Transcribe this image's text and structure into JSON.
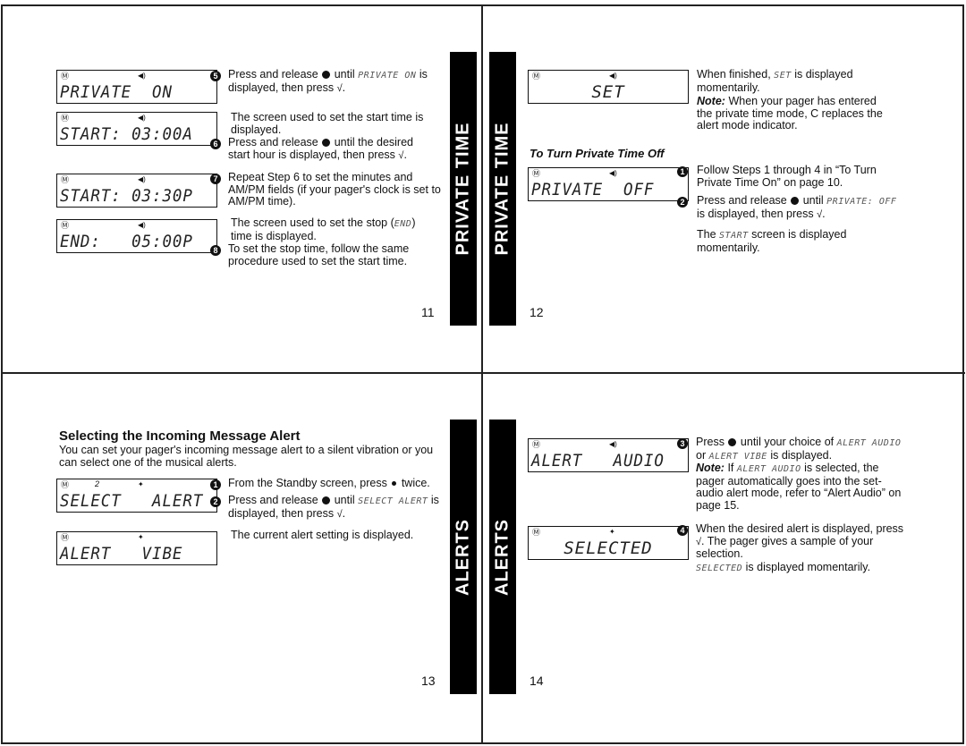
{
  "pages": {
    "p11": {
      "page_number": "11",
      "tab_label": "PRIVATE TIME",
      "lcd_screens": [
        {
          "text": "PRIVATE  ON",
          "logo": "motorola-logo",
          "indicator": "speaker-icon"
        },
        {
          "text": "START: 03:00A",
          "logo": "motorola-logo",
          "indicator": "speaker-icon"
        },
        {
          "text": "START: 03:30P",
          "logo": "motorola-logo",
          "indicator": "speaker-icon"
        },
        {
          "text": "END:   05:00P",
          "logo": "motorola-logo",
          "indicator": "speaker-icon"
        }
      ],
      "steps": [
        {
          "num": "5",
          "pre": "Press and release",
          "mid": "until",
          "lcd": "PRIVATE ON",
          "post": "is displayed, then press",
          "end": "."
        },
        {
          "plain": "The screen used to set the start time is displayed."
        },
        {
          "num": "6",
          "pre": "Press and release",
          "post": "until the desired start hour is displayed, then press",
          "end": "."
        },
        {
          "num": "7",
          "text": "Repeat Step 6 to set the minutes and AM/PM fields (if your pager's clock is set to AM/PM time)."
        },
        {
          "plain_pre": "The screen used to set the stop (",
          "lcd": "END",
          "plain_post": ") time is displayed."
        },
        {
          "num": "8",
          "text": "To set the stop time, follow the same procedure used to set the start time."
        }
      ]
    },
    "p12": {
      "page_number": "12",
      "tab_label": "PRIVATE TIME",
      "lcd_screens": [
        {
          "text": "SET",
          "logo": "motorola-logo",
          "indicator": "speaker-icon"
        },
        {
          "text": "PRIVATE  OFF",
          "logo": "motorola-logo",
          "indicator": "speaker-icon"
        }
      ],
      "intro": {
        "pre": "When finished,",
        "lcd": "SET",
        "post": "is displayed momentarily."
      },
      "note": {
        "label": "Note:",
        "pre": "When your pager has entered the private time mode,",
        "symbol": "C",
        "post": "replaces the alert mode indicator."
      },
      "subheading": "To Turn Private Time Off",
      "steps": [
        {
          "num": "1",
          "text": "Follow Steps 1 through 4 in “To Turn Private Time On” on page 10."
        },
        {
          "num": "2",
          "pre": "Press and release",
          "mid": "until",
          "lcd": "PRIVATE: OFF",
          "post": "is displayed, then press",
          "end": "."
        },
        {
          "plain_pre": "The",
          "lcd": "START",
          "plain_post": "screen is displayed momentarily."
        }
      ]
    },
    "p13": {
      "page_number": "13",
      "tab_label": "ALERTS",
      "heading": "Selecting the Incoming Message Alert",
      "intro": "You can set your pager's incoming message alert to a silent vibration or you can select one of the musical alerts.",
      "lcd_screens": [
        {
          "text": "SELECT   ALERT",
          "logo": "motorola-logo",
          "number": "2",
          "indicator": "vibrate-icon"
        },
        {
          "text": "ALERT   VIBE",
          "logo": "motorola-logo",
          "indicator": "vibrate-icon"
        }
      ],
      "steps": [
        {
          "num": "1",
          "pre": "From the Standby screen, press",
          "post": "twice."
        },
        {
          "num": "2",
          "pre": "Press and release",
          "mid": "until",
          "lcd": "SELECT ALERT",
          "post": "is displayed, then press",
          "end": "."
        },
        {
          "plain": "The current alert setting is displayed."
        }
      ]
    },
    "p14": {
      "page_number": "14",
      "tab_label": "ALERTS",
      "lcd_screens": [
        {
          "text": "ALERT   AUDIO",
          "logo": "motorola-logo",
          "indicator": "speaker-icon"
        },
        {
          "text": "SELECTED",
          "logo": "motorola-logo",
          "indicator": "vibrate-icon"
        }
      ],
      "steps": [
        {
          "num": "3",
          "pre": "Press",
          "mid": "until your choice of",
          "lcd": "ALERT AUDIO",
          "or": "or",
          "lcd2": "ALERT VIBE",
          "post": "is displayed."
        },
        {
          "note_label": "Note:",
          "pre": "If",
          "lcd": "ALERT AUDIO",
          "post": "is selected, the pager automatically goes into the set-audio alert mode, refer to “Alert Audio” on page 15."
        },
        {
          "num": "4",
          "pre": "When the desired alert is displayed, press",
          "post": ". The pager gives a sample of your selection."
        },
        {
          "lcd": "SELECTED",
          "post": "is displayed momentarily."
        }
      ]
    }
  },
  "symbols": {
    "check": "√",
    "motorola": "Ⓜ",
    "speaker": "◀)",
    "vibrate": "✦"
  }
}
